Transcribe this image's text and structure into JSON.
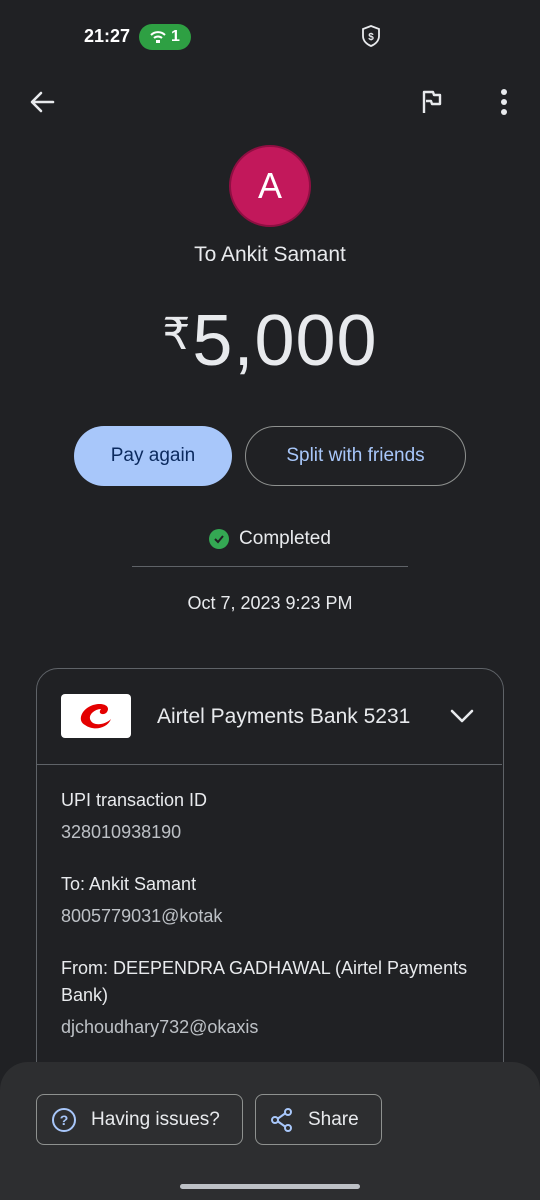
{
  "status_bar": {
    "time": "21:27",
    "hotspot_count": "1"
  },
  "transaction": {
    "avatar_letter": "A",
    "to_title": "To Ankit Samant",
    "currency": "₹",
    "amount": "5,000",
    "status": "Completed",
    "datetime": "Oct 7, 2023 9:23 PM"
  },
  "actions": {
    "pay_again": "Pay again",
    "split": "Split with friends"
  },
  "details": {
    "bank": "Airtel Payments Bank 5231",
    "upi_label": "UPI transaction ID",
    "upi_id": "328010938190",
    "to_label": "To: Ankit Samant",
    "to_upi": "8005779031@kotak",
    "from_label": "From: DEEPENDRA GADHAWAL (Airtel Payments Bank)",
    "from_upi": "djchoudhary732@okaxis"
  },
  "bottom": {
    "issues": "Having issues?",
    "share": "Share"
  },
  "colors": {
    "background": "#202124",
    "accent": "#a8c7fa",
    "avatar": "#c2185b",
    "success": "#34a853",
    "hotspot": "#2ea043"
  },
  "icons": [
    "hotspot-icon",
    "shield-icon",
    "back-arrow-icon",
    "flag-icon",
    "more-vert-icon",
    "check-circle-icon",
    "airtel-logo-icon",
    "chevron-down-icon",
    "help-icon",
    "share-icon"
  ]
}
